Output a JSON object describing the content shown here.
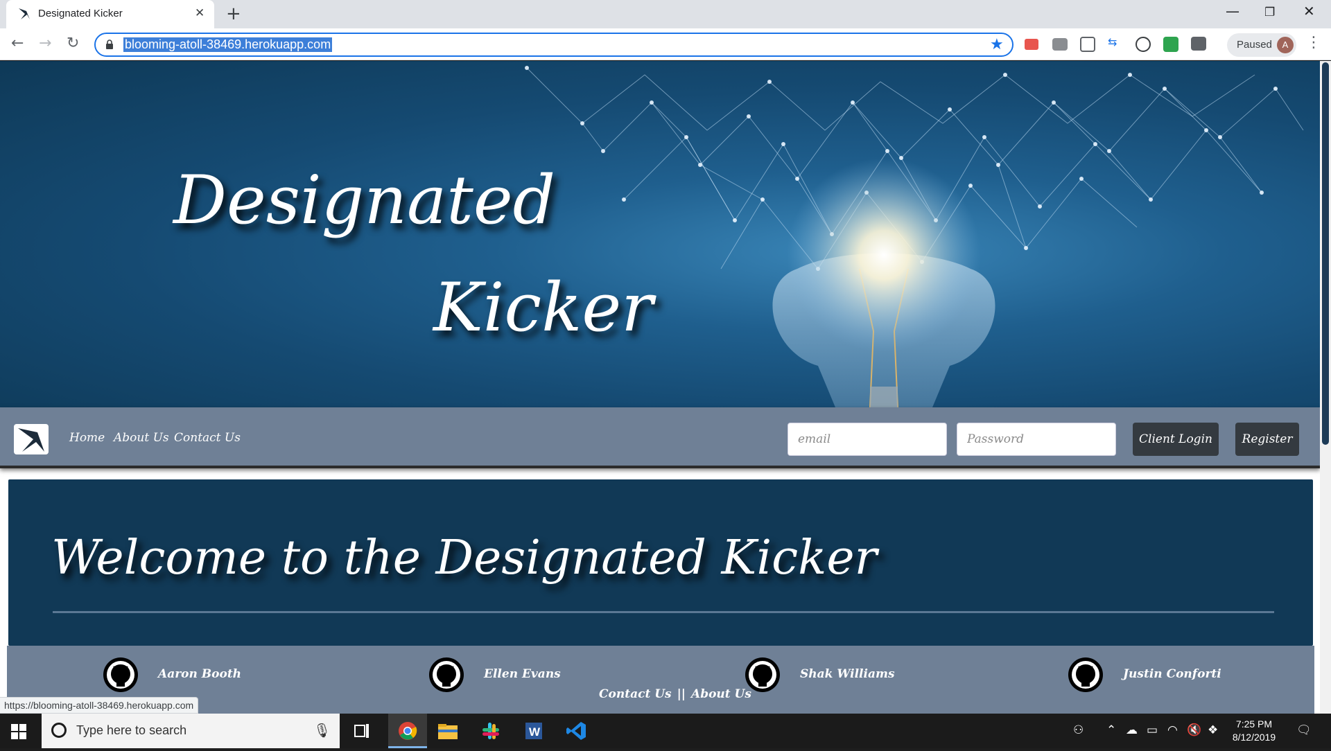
{
  "browser": {
    "tab_title": "Designated Kicker",
    "url": "blooming-atoll-38469.herokuapp.com",
    "paused_label": "Paused",
    "profile_initial": "A",
    "status_url": "https://blooming-atoll-38469.herokuapp.com"
  },
  "hero": {
    "line1": "Designated",
    "line2": "Kicker"
  },
  "nav": {
    "links": [
      "Home",
      "About Us",
      "Contact Us"
    ],
    "email_placeholder": "email",
    "password_placeholder": "Password",
    "login_label": "Client Login",
    "register_label": "Register"
  },
  "welcome": {
    "title": "Welcome to the Designated Kicker"
  },
  "footer": {
    "members": [
      "Aaron Booth",
      "Ellen Evans",
      "Shak Williams",
      "Justin Conforti"
    ],
    "contact_label": "Contact Us",
    "separator": "||",
    "about_label": "About Us"
  },
  "taskbar": {
    "search_placeholder": "Type here to search",
    "time": "7:25 PM",
    "date": "8/12/2019"
  },
  "colors": {
    "hero_dark": "#0e3957",
    "navbar": "#6f8096",
    "welcome_panel": "#113956",
    "button_dark": "#343a40"
  }
}
